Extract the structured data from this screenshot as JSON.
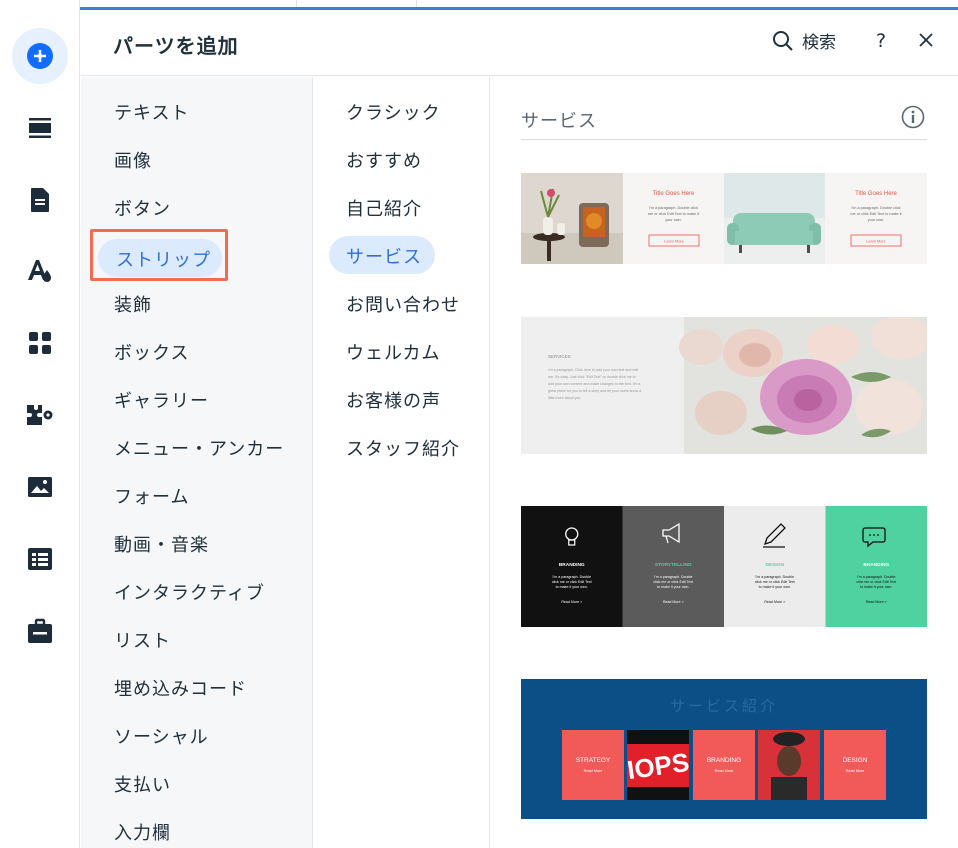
{
  "header": {
    "title": "パーツを追加",
    "search_label": "検索",
    "help_label": "?"
  },
  "categories": [
    "テキスト",
    "画像",
    "ボタン",
    "ストリップ",
    "装飾",
    "ボックス",
    "ギャラリー",
    "メニュー・アンカー",
    "フォーム",
    "動画・音楽",
    "インタラクティブ",
    "リスト",
    "埋め込みコード",
    "ソーシャル",
    "支払い",
    "入力欄"
  ],
  "selected_category": "ストリップ",
  "subcategories": [
    "クラシック",
    "おすすめ",
    "自己紹介",
    "サービス",
    "お問い合わせ",
    "ウェルカム",
    "お客様の声",
    "スタッフ紹介"
  ],
  "selected_subcategory": "サービス",
  "section": {
    "title": "サービス"
  },
  "thumbnails": {
    "t1": {
      "panel_title": "Title Goes Here",
      "panel_body_1": "I'm a paragraph. Double click",
      "panel_body_2": "me or click Edit Text to make it",
      "panel_body_3": "your own.",
      "button": "Learn More"
    },
    "t2": {
      "heading": "SERVICES",
      "body": "I'm a paragraph. Click here to add your own text and edit me. It's easy. Just click \"Edit Text\" or double click me to add your own content and make changes to the font. I'm a great place for you to tell a story and let your users know a little more about you."
    },
    "t3": {
      "cards": [
        {
          "title": "BRANDING",
          "icon": "lightbulb-icon",
          "bg": "#111111",
          "fg": "#ffffff",
          "title_color": "#ffffff"
        },
        {
          "title": "STORYTELLING",
          "icon": "megaphone-icon",
          "bg": "#5c5b5b",
          "fg": "#ffffff",
          "title_color": "#4fd1a0"
        },
        {
          "title": "DESIGN",
          "icon": "pencil-icon",
          "bg": "#ececec",
          "fg": "#111111",
          "title_color": "#4fd1a0"
        },
        {
          "title": "BRANDING",
          "icon": "chat-bubble-icon",
          "bg": "#4fd1a0",
          "fg": "#111111",
          "title_color": "#ffffff"
        }
      ],
      "body_1": "I'm a paragraph. Double",
      "body_2": "click me or click Edit Text",
      "body_3": "to make it your own.",
      "read_more": "Read More >"
    },
    "t4": {
      "title": "サービス紹介",
      "cards": [
        "STRATEGY",
        "BRANDING",
        "DESIGN"
      ],
      "card_sub": "Read More",
      "photo_text": "IOPS"
    }
  },
  "colors": {
    "accent": "#2f6fd9",
    "selected_bg": "#dceafd",
    "highlight_border": "#f26d50",
    "t4_bg": "#0b4f86",
    "t4_card": "#f25a5a"
  }
}
